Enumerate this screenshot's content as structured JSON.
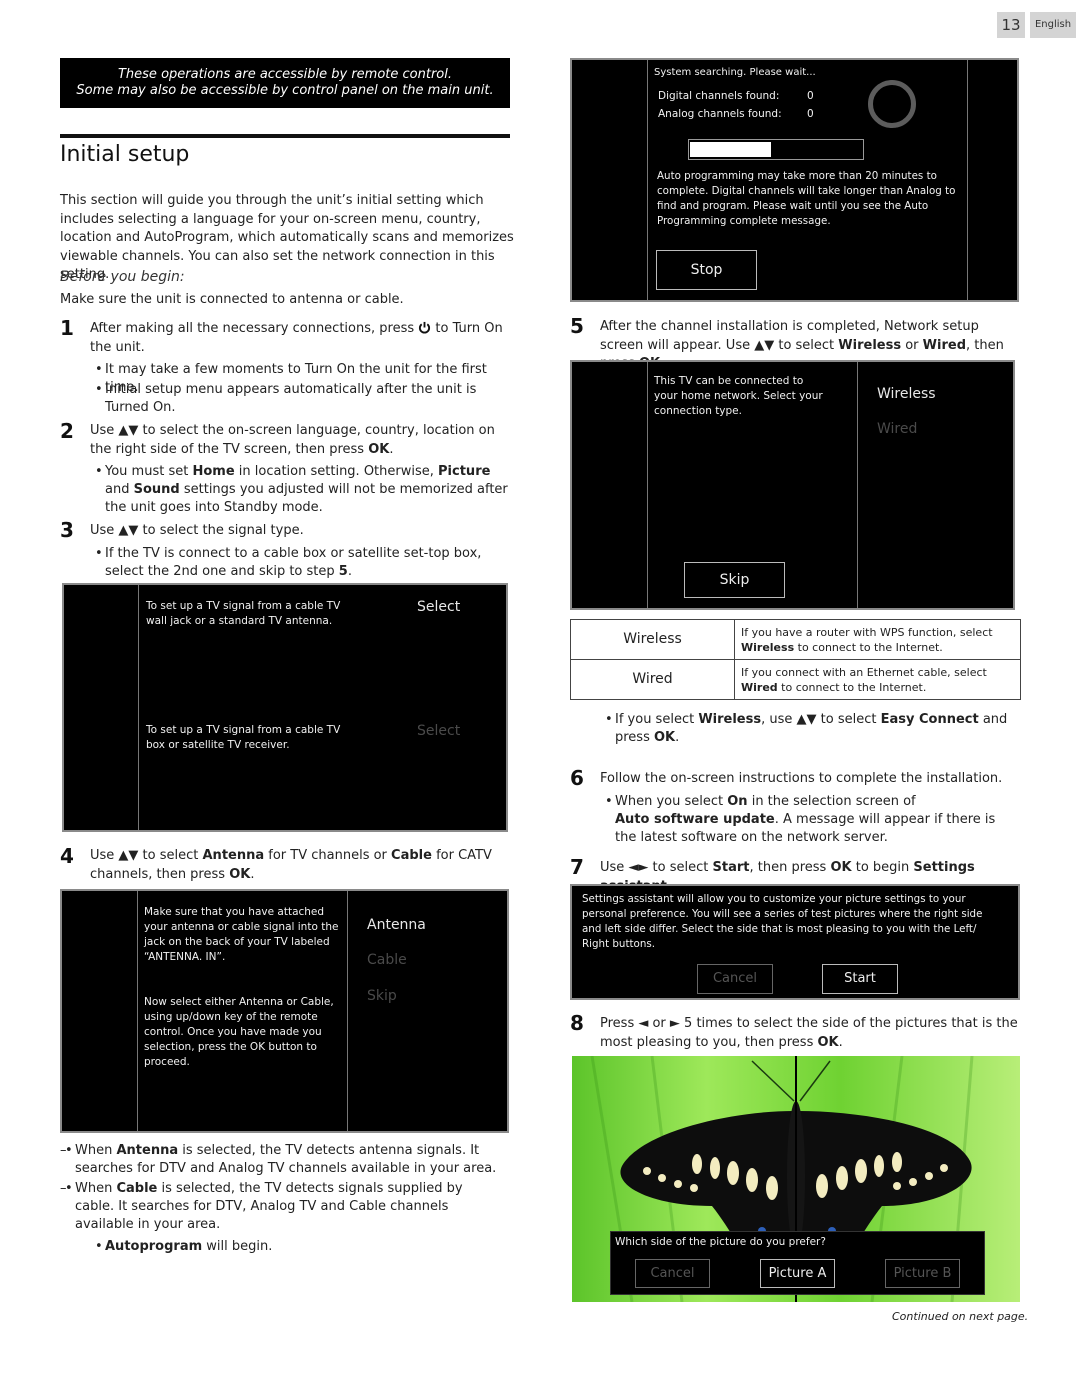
{
  "header": {
    "page_number": "13",
    "language": "English"
  },
  "banner": {
    "line1": "These operations are accessible by remote control.",
    "line2": "Some may also be accessible by control panel on the main unit."
  },
  "section_title": "Initial setup",
  "intro": "This section will guide you through the unit’s initial setting which includes selecting a language for your on-screen menu, country, location and AutoProgram, which automatically scans and memorizes viewable channels. You can also set the network connection in this setting.",
  "before_you_begin": {
    "heading": "Before you begin:",
    "text": "Make sure the unit is connected to antenna or cable."
  },
  "steps": [
    {
      "n": "1",
      "text_a": "After making all the necessary connections, press",
      "icon": "power-icon",
      "text_b": "to Turn On the unit.",
      "bullets": [
        "It may take a few moments to Turn On the unit for the first time.",
        "Initial setup menu appears automatically after the unit is Turned On."
      ]
    },
    {
      "n": "2",
      "text_a": "Use ▲▼ to select the on-screen language, country, location on the right side of the TV screen, then press",
      "bold_end": "OK",
      "bullet": {
        "a": "You must set",
        "b1": "Home",
        "c": "in location setting. Otherwise,",
        "b2": "Picture",
        "d": "and",
        "b3": "Sound",
        "e": "settings you adjusted will not be memorized after the unit goes into Standby mode."
      }
    },
    {
      "n": "3",
      "text": "Use ▲▼ to select the signal type.",
      "bullet_a": "If the TV is connect to a cable box or satellite set-top box, select the 2nd one and skip to step",
      "bullet_b": "5"
    },
    {
      "n": "4",
      "a": "Use ▲▼ to select",
      "b1": "Antenna",
      "c": "for TV channels or",
      "b2": "Cable",
      "d": "for CATV channels, then press",
      "b3": "OK"
    },
    {
      "n": "5",
      "a": "After the channel installation is completed, Network setup screen will appear. Use ▲▼ to select",
      "b1": "Wireless",
      "c": "or",
      "b2": "Wired",
      "d": ", then press",
      "b3": "OK"
    },
    {
      "n": "6",
      "text": "Follow the on-screen instructions to complete the installation.",
      "bullet": {
        "a": "When you select",
        "b1": "On",
        "c": "in the selection screen of",
        "b2": "Auto software update",
        "d": ". A message will appear if there is the latest software on the network server."
      }
    },
    {
      "n": "7",
      "a": "Use ◄► to select",
      "b1": "Start",
      "c": ", then press",
      "b2": "OK",
      "d": "to begin",
      "b3": "Settings assistant"
    },
    {
      "n": "8",
      "a": "Press ◄ or ► 5 times to select the side of the pictures that is the most pleasing to you, then press",
      "b1": "OK"
    }
  ],
  "signal_screen": {
    "option1_text": "To set up a TV signal from a cable TV wall jack or a standard TV antenna.",
    "option1_label": "Select",
    "option2_text": "To set up a TV signal from a cable TV box or satellite TV receiver.",
    "option2_label": "Select"
  },
  "antenna_screen": {
    "text1": "Make sure that you have attached your antenna or cable signal into the jack on the back of your TV labeled “ANTENNA. IN”.",
    "text2": "Now select either Antenna or Cable, using up/down key of the remote control. Once you have made you selection, press the OK button to proceed.",
    "options": [
      "Antenna",
      "Cable",
      "Skip"
    ],
    "selected": "Antenna"
  },
  "notes": {
    "antenna": {
      "b": "Antenna",
      "t": "is selected, the TV detects antenna signals. It searches for DTV and Analog TV channels available in your area."
    },
    "cable": {
      "b": "Cable",
      "t": "is selected, the TV detects signals supplied by cable. It searches for DTV, Analog TV and Cable channels available in your area."
    },
    "prefix": "When",
    "autoprogram_b": "Autoprogram",
    "autoprogram_t": "will begin."
  },
  "search_screen": {
    "status": "System searching. Please wait...",
    "digital_label": "Digital channels found:",
    "digital_value": "0",
    "analog_label": "Analog channels found:",
    "analog_value": "0",
    "progress_fraction": 0.47,
    "message": "Auto programming may take more than 20 minutes to complete. Digital channels will take longer than Analog to find and program. Please wait until you see the Auto Programming complete message.",
    "stop_label": "Stop"
  },
  "network_screen": {
    "text": "This TV can be connected to your home network. Select your connection type.",
    "options": [
      "Wireless",
      "Wired"
    ],
    "selected": "Wireless",
    "skip_label": "Skip"
  },
  "network_table": [
    {
      "key": "Wireless",
      "a": "If you have a router with WPS function, select",
      "b": "Wireless",
      "c": "to connect to the Internet."
    },
    {
      "key": "Wired",
      "a": "If you connect with an Ethernet cable, select",
      "b": "Wired",
      "c": "to connect to the Internet."
    }
  ],
  "wireless_note": {
    "a": "If you select",
    "b1": "Wireless",
    "c": ", use ▲▼ to select",
    "b2": "Easy Connect",
    "d": "and press",
    "b3": "OK"
  },
  "assistant_screen": {
    "text": "Settings assistant will allow you to customize your picture settings to your personal preference. You will see a series of test pictures where the right side and left side differ. Select the side that is most pleasing to you with the Left/ Right buttons.",
    "cancel_label": "Cancel",
    "start_label": "Start"
  },
  "picture_screen": {
    "question": "Which side of the picture do you prefer?",
    "cancel_label": "Cancel",
    "picture_a_label": "Picture A",
    "picture_b_label": "Picture B"
  },
  "continued": "Continued on next page."
}
